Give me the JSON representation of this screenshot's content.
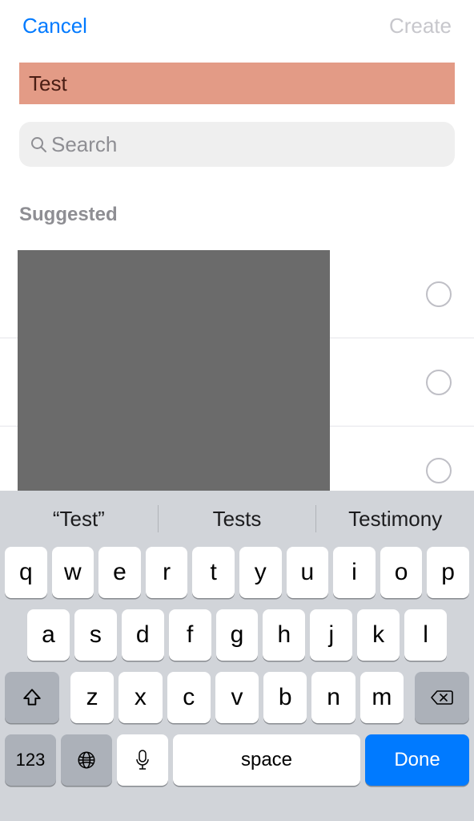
{
  "nav": {
    "cancel": "Cancel",
    "create": "Create"
  },
  "title_field": {
    "value": "Test"
  },
  "search": {
    "placeholder": "Search"
  },
  "section": {
    "suggested": "Suggested"
  },
  "keyboard": {
    "candidates": [
      "“Test”",
      "Tests",
      "Testimony"
    ],
    "rows": {
      "r1": [
        "q",
        "w",
        "e",
        "r",
        "t",
        "y",
        "u",
        "i",
        "o",
        "p"
      ],
      "r2": [
        "a",
        "s",
        "d",
        "f",
        "g",
        "h",
        "j",
        "k",
        "l"
      ],
      "r3": [
        "z",
        "x",
        "c",
        "v",
        "b",
        "n",
        "m"
      ]
    },
    "numkey": "123",
    "space": "space",
    "done": "Done"
  }
}
